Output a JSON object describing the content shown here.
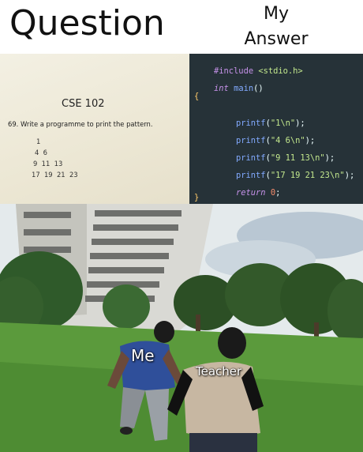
{
  "headers": {
    "question": "Question",
    "answer_line1": "My",
    "answer_line2": "Answer"
  },
  "paper": {
    "course": "CSE 102",
    "question": "69. Write a programme to print the pattern.",
    "pattern": [
      "1",
      "4  6",
      "9  11  13",
      "17  19  21  23"
    ]
  },
  "code": {
    "include_kw": "#include",
    "include_hdr": "<stdio.h>",
    "main_kw": "int",
    "main_fn": "main",
    "main_parens": "()",
    "open_brace": "{",
    "printf": "printf",
    "lines": [
      "\"1\\n\"",
      "\"4 6\\n\"",
      "\"9 11 13\\n\"",
      "\"17 19 21 23\\n\""
    ],
    "return_kw": "return",
    "return_val": "0",
    "close_brace": "}"
  },
  "labels": {
    "me": "Me",
    "teacher": "Teacher"
  }
}
